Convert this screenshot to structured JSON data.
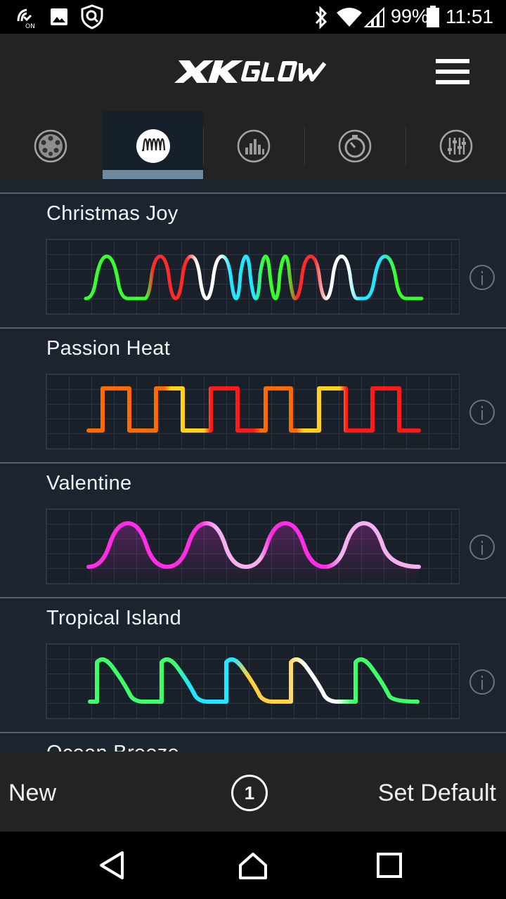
{
  "status_bar": {
    "battery": "99%",
    "time": "11:51",
    "left_icons": [
      "nfc-on-icon",
      "gallery-icon",
      "shield-search-icon"
    ],
    "right_icons": [
      "bluetooth-icon",
      "wifi-icon",
      "signal-icon",
      "battery-icon"
    ]
  },
  "header": {
    "logo_text": "XKGLOW",
    "menu_icon": "hamburger-menu-icon"
  },
  "tabs": [
    {
      "icon": "palette-icon",
      "active": false
    },
    {
      "icon": "wave-pattern-icon",
      "active": true
    },
    {
      "icon": "equalizer-icon",
      "active": false
    },
    {
      "icon": "timer-icon",
      "active": false
    },
    {
      "icon": "sliders-icon",
      "active": false
    }
  ],
  "patterns": [
    {
      "title": "Christmas Joy",
      "colors": [
        "#39ff2e",
        "#ff2a2a",
        "#ffffff",
        "#22e8ff",
        "#39ff2e",
        "#ff2a2a",
        "#ffffff",
        "#22e8ff",
        "#39ff2e"
      ]
    },
    {
      "title": "Passion Heat",
      "colors": [
        "#ff6a00",
        "#ffd21a",
        "#ff1a1a",
        "#ff6a00",
        "#ffd21a",
        "#ff1a1a"
      ]
    },
    {
      "title": "Valentine",
      "colors": [
        "#ff2ee6",
        "#f5b0f0",
        "#ff2ee6",
        "#f5b0f0"
      ]
    },
    {
      "title": "Tropical Island",
      "colors": [
        "#3dff6a",
        "#22e8ff",
        "#ffd040",
        "#ffffff",
        "#3dff6a"
      ]
    },
    {
      "title": "Ocean Breeze",
      "colors": []
    }
  ],
  "bottom_bar": {
    "new_label": "New",
    "count": "1",
    "set_default_label": "Set Default"
  },
  "nav": {
    "back_icon": "back-icon",
    "home_icon": "home-icon",
    "recents_icon": "recents-icon"
  }
}
